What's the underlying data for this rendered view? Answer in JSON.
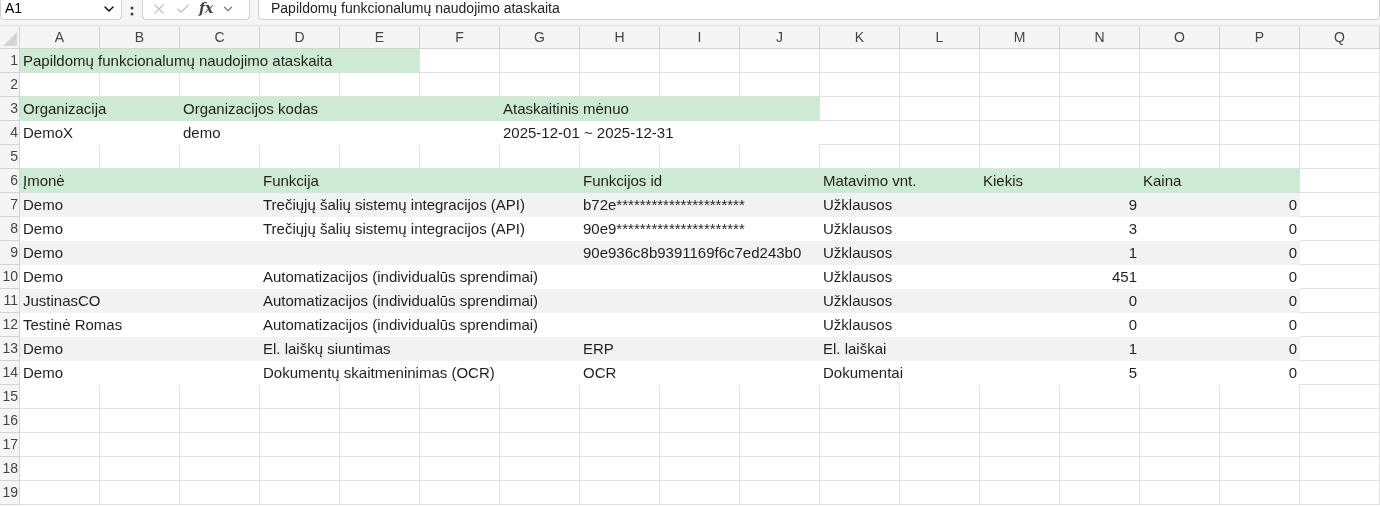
{
  "formula_bar": {
    "name_box": "A1",
    "fx_label": "fx",
    "formula": "Papildomų funkcionalumų naudojimo ataskaita"
  },
  "column_headers": [
    "A",
    "B",
    "C",
    "D",
    "E",
    "F",
    "G",
    "H",
    "I",
    "J",
    "K",
    "L",
    "M",
    "N",
    "O",
    "P",
    "Q"
  ],
  "row_numbers": [
    "1",
    "2",
    "3",
    "4",
    "5",
    "6",
    "7",
    "8",
    "9",
    "10",
    "11",
    "12",
    "13",
    "14",
    "15",
    "16",
    "17",
    "18",
    "19"
  ],
  "report_title": "Papildomų funkcionalumų naudojimo ataskaita",
  "info_headers": [
    "Organizacija",
    "Organizacijos kodas",
    "Ataskaitinis mėnuo"
  ],
  "info_values": [
    "DemoX",
    "demo",
    "2025-12-01 ~ 2025-12-31"
  ],
  "table": {
    "columns": [
      "Įmonė",
      "Funkcija",
      "Funkcijos id",
      "Matavimo vnt.",
      "Kiekis",
      "Kaina"
    ],
    "rows": [
      [
        "Demo",
        "Trečiųjų šalių sistemų integracijos (API)",
        "b72e**********************",
        "Užklausos",
        "9",
        "0"
      ],
      [
        "Demo",
        "Trečiųjų šalių sistemų integracijos (API)",
        "90e9**********************",
        "Užklausos",
        "3",
        "0"
      ],
      [
        "Demo",
        "",
        "90e936c8b9391169f6c7ed243b0",
        "Užklausos",
        "1",
        "0"
      ],
      [
        "Demo",
        "Automatizacijos (individualūs sprendimai)",
        "",
        "Užklausos",
        "451",
        "0"
      ],
      [
        "JustinasCO",
        "Automatizacijos (individualūs sprendimai)",
        "",
        "Užklausos",
        "0",
        "0"
      ],
      [
        "Testinė Romas",
        "Automatizacijos (individualūs sprendimai)",
        "",
        "Užklausos",
        "0",
        "0"
      ],
      [
        "Demo",
        "El. laiškų siuntimas",
        "ERP",
        "El. laiškai",
        "1",
        "0"
      ],
      [
        "Demo",
        "Dokumentų skaitmeninimas (OCR)",
        "OCR",
        "Dokumentai",
        "5",
        "0"
      ]
    ]
  }
}
